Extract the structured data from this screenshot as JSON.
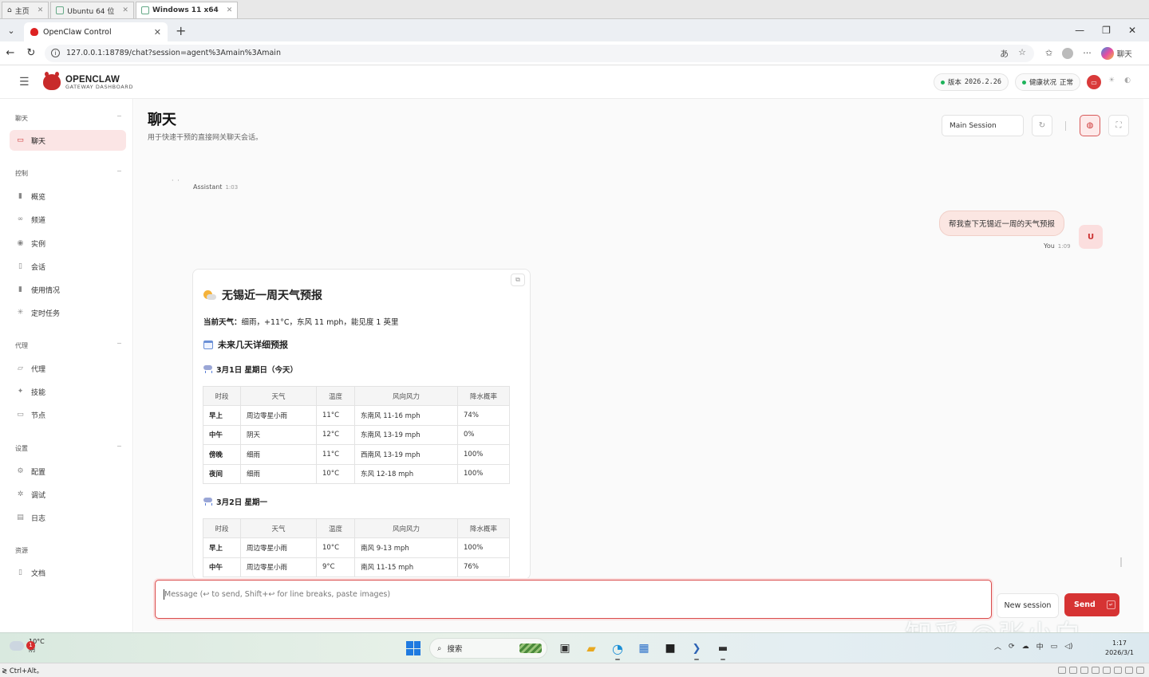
{
  "vm_tabs": [
    {
      "label": "主页",
      "active": false
    },
    {
      "label": "Ubuntu 64 位",
      "active": false
    },
    {
      "label": "Windows 11 x64",
      "active": true
    }
  ],
  "browser": {
    "tab_title": "OpenClaw Control",
    "url": "127.0.0.1:18789/chat?session=agent%3Amain%3Amain",
    "copilot_label": "聊天"
  },
  "app": {
    "brand_title": "OPENCLAW",
    "brand_subtitle": "GATEWAY DASHBOARD",
    "version_label": "版本",
    "version_value": "2026.2.26",
    "health_label": "健康状况",
    "health_value": "正常"
  },
  "sidebar": {
    "sections": [
      {
        "title": "聊天",
        "items": [
          {
            "label": "聊天",
            "icon": "chat-icon",
            "active": true
          }
        ]
      },
      {
        "title": "控制",
        "items": [
          {
            "label": "概览",
            "icon": "bar-chart-icon"
          },
          {
            "label": "频道",
            "icon": "link-icon"
          },
          {
            "label": "实例",
            "icon": "radio-icon"
          },
          {
            "label": "会话",
            "icon": "document-icon"
          },
          {
            "label": "使用情况",
            "icon": "bar-chart-icon"
          },
          {
            "label": "定时任务",
            "icon": "loader-icon"
          }
        ]
      },
      {
        "title": "代理",
        "items": [
          {
            "label": "代理",
            "icon": "folder-icon"
          },
          {
            "label": "技能",
            "icon": "sparkle-icon"
          },
          {
            "label": "节点",
            "icon": "monitor-icon"
          }
        ]
      },
      {
        "title": "设置",
        "items": [
          {
            "label": "配置",
            "icon": "settings-icon"
          },
          {
            "label": "调试",
            "icon": "bug-icon"
          },
          {
            "label": "日志",
            "icon": "scroll-icon"
          }
        ]
      },
      {
        "title": "资源",
        "items": [
          {
            "label": "文档",
            "icon": "book-icon"
          }
        ]
      }
    ]
  },
  "main": {
    "title": "聊天",
    "subtitle": "用于快速干预的直接网关聊天会话。",
    "session_select": "Main Session"
  },
  "chat": {
    "assistant_name": "Assistant",
    "assistant_time": "1:03",
    "user_message": "帮我查下无锡近一周的天气预报",
    "user_avatar": "U",
    "user_name": "You",
    "user_time": "1:09",
    "card": {
      "heading": "无锡近一周天气预报",
      "current_label": "当前天气：",
      "current_value": "细雨，+11°C，东风 11 mph，能见度 1 英里",
      "subheading": "未来几天详细预报",
      "table_headers": [
        "时段",
        "天气",
        "温度",
        "风向风力",
        "降水概率"
      ],
      "days": [
        {
          "title": "3月1日 星期日（今天）",
          "rows": [
            [
              "早上",
              "周边零星小雨",
              "11°C",
              "东南风 11-16 mph",
              "74%"
            ],
            [
              "中午",
              "阴天",
              "12°C",
              "东南风 13-19 mph",
              "0%"
            ],
            [
              "傍晚",
              "细雨",
              "11°C",
              "西南风 13-19 mph",
              "100%"
            ],
            [
              "夜间",
              "细雨",
              "10°C",
              "东风 12-18 mph",
              "100%"
            ]
          ]
        },
        {
          "title": "3月2日 星期一",
          "rows": [
            [
              "早上",
              "周边零星小雨",
              "10°C",
              "南风 9-13 mph",
              "100%"
            ],
            [
              "中午",
              "周边零星小雨",
              "9°C",
              "南风 11-15 mph",
              "76%"
            ]
          ]
        }
      ]
    }
  },
  "composer": {
    "placeholder": "Message (↩ to send, Shift+↩ for line breaks, paste images)",
    "new_session": "New session",
    "send": "Send"
  },
  "watermark": "知乎 @张小白",
  "taskbar": {
    "weather_temp": "10°C",
    "weather_desc": "阴",
    "weather_badge": "1",
    "search_placeholder": "搜索",
    "ime": "中",
    "time": "1:17",
    "date": "2026/3/1"
  },
  "statusbar": {
    "text": "≷ Ctrl+Alt。"
  }
}
